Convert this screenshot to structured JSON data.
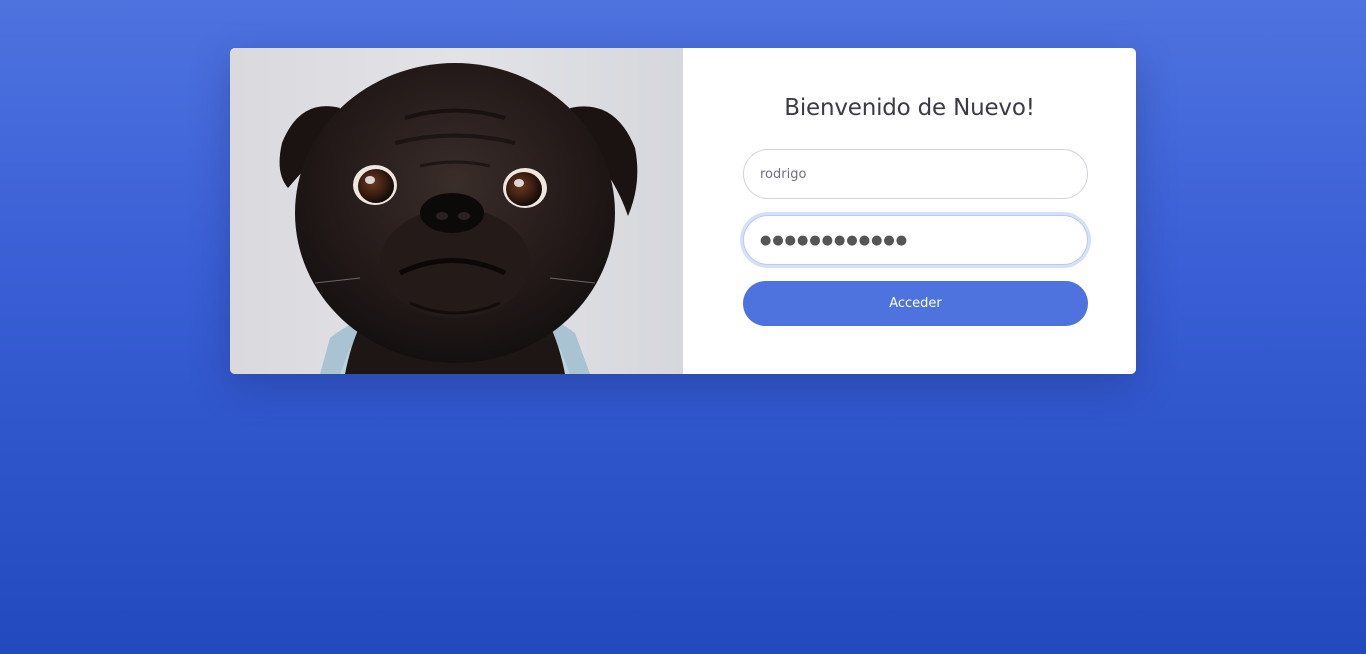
{
  "login": {
    "heading": "Bienvenido de Nuevo!",
    "username_value": "rodrigo",
    "password_masked": "●●●●●●●●●●●●",
    "submit_label": "Acceder"
  },
  "colors": {
    "background_top": "#4e73df",
    "background_bottom": "#224abe",
    "button": "#4e73df",
    "heading_text": "#3a3b45"
  },
  "image": {
    "subject": "pug-dog-photo"
  }
}
